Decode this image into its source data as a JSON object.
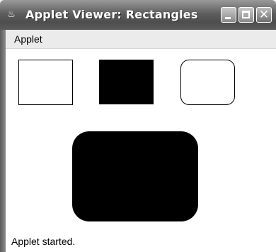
{
  "window": {
    "title": "Applet Viewer: Rectangles",
    "app_icon": "java-cup-icon",
    "controls": {
      "minimize_icon": "minimize-icon",
      "maximize_icon": "maximize-icon",
      "close_icon": "close-icon",
      "close_glyph": "✕"
    }
  },
  "menubar": {
    "items": [
      {
        "label": "Applet"
      }
    ]
  },
  "status": {
    "text": "Applet started."
  },
  "colors": {
    "shape_fill": "#000000",
    "canvas_bg": "#ffffff",
    "titlebar": "#5e5e5e"
  }
}
